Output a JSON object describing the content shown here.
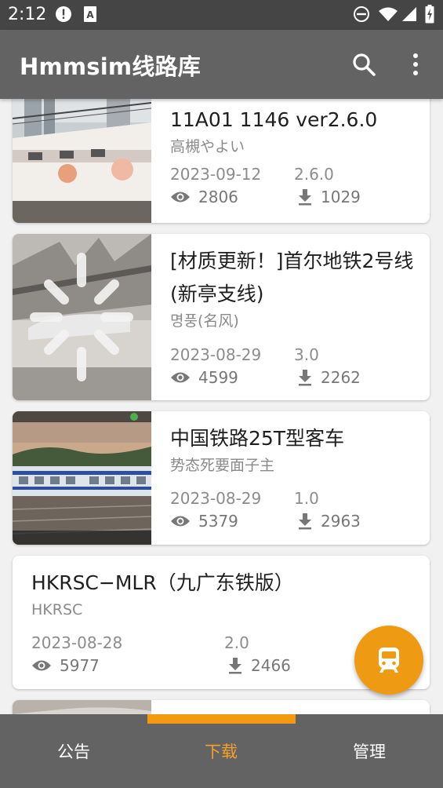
{
  "status_bar": {
    "time": "2:12",
    "icons": [
      "alert-icon",
      "sim-a-icon",
      "do-not-disturb-icon",
      "wifi-icon",
      "signal-icon",
      "battery-charging-icon"
    ]
  },
  "app_bar": {
    "title": "Hmmsim线路库",
    "search_icon": "search-icon",
    "more_icon": "more-vert-icon"
  },
  "routes": [
    {
      "title": "11A01 1146 ver2.6.0",
      "author": "高槻やよい",
      "date": "2023-09-12",
      "version": "2.6.0",
      "views": "2806",
      "downloads": "1029",
      "has_thumbnail": true
    },
    {
      "title": "[材质更新！]首尔地铁2号线(新亭支线)",
      "author": "명풍(名风)",
      "date": "2023-08-29",
      "version": "3.0",
      "views": "4599",
      "downloads": "2262",
      "has_thumbnail": true
    },
    {
      "title": "中国铁路25T型客车",
      "author": "势态死要面子主",
      "date": "2023-08-29",
      "version": "1.0",
      "views": "5379",
      "downloads": "2963",
      "has_thumbnail": true
    },
    {
      "title": "HKRSC−MLR（九广东铁版）",
      "author": "HKRSC",
      "date": "2023-08-28",
      "version": "2.0",
      "views": "5977",
      "downloads": "2466",
      "has_thumbnail": false
    }
  ],
  "fab": {
    "icon": "train-icon",
    "color": "#ef9a13"
  },
  "bottom_nav": {
    "items": [
      {
        "label": "公告",
        "active": false
      },
      {
        "label": "下载",
        "active": true
      },
      {
        "label": "管理",
        "active": false
      }
    ]
  },
  "colors": {
    "accent": "#ef9a13",
    "app_bar": "#636363",
    "status_bar": "#454545",
    "background": "#f1f1f1"
  }
}
